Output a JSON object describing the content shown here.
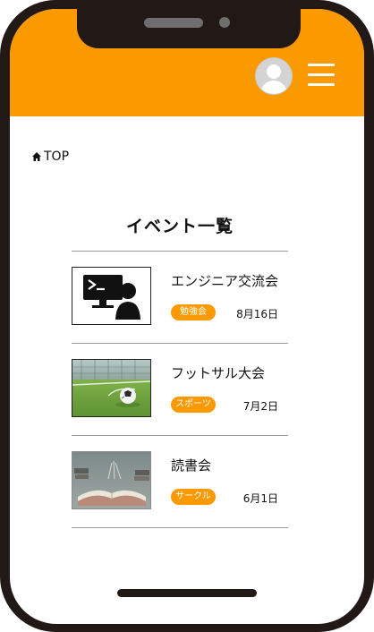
{
  "breadcrumb": {
    "label": "TOP"
  },
  "page": {
    "title": "イベント一覧"
  },
  "events": [
    {
      "title": "エンジニア交流会",
      "tag": "勉強会",
      "date": "8月16日",
      "image": "engineer-presentation-icon"
    },
    {
      "title": "フットサル大会",
      "tag": "スポーツ",
      "date": "7月2日",
      "image": "futsal-ball-photo"
    },
    {
      "title": "読書会",
      "tag": "サークル",
      "date": "6月1日",
      "image": "open-book-photo"
    }
  ],
  "colors": {
    "accent": "#fa9a00",
    "frame": "#221816"
  }
}
